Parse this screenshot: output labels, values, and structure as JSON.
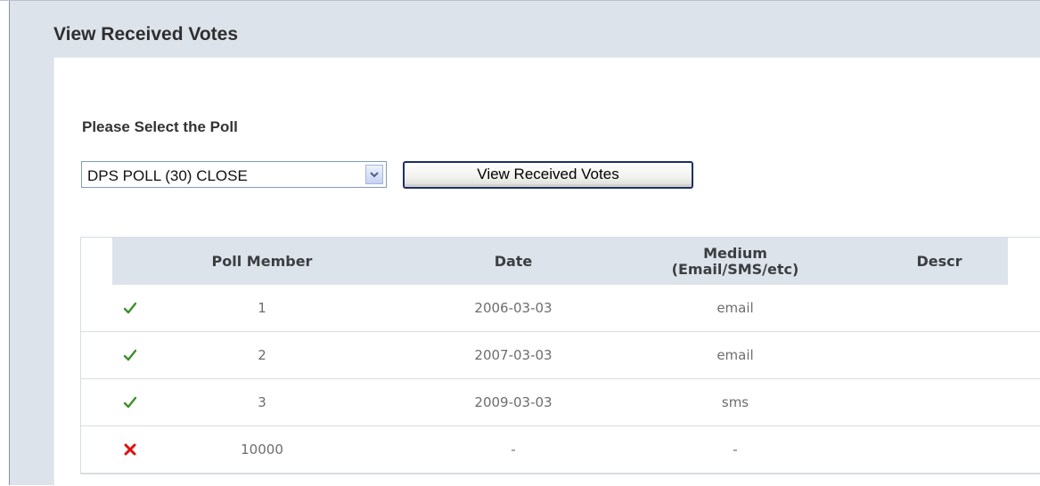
{
  "panel": {
    "title": "View Received Votes"
  },
  "poll_select": {
    "label": "Please Select the Poll",
    "selected": "DPS POLL (30) CLOSE",
    "button_label": "View Received Votes"
  },
  "table": {
    "headers": {
      "member": "Poll Member",
      "date": "Date",
      "medium_line1": "Medium",
      "medium_line2": "(Email/SMS/etc)",
      "descr": "Descr"
    },
    "rows": [
      {
        "status": "received",
        "member": "1",
        "date": "2006-03-03",
        "medium": "email",
        "descr": ""
      },
      {
        "status": "received",
        "member": "2",
        "date": "2007-03-03",
        "medium": "email",
        "descr": ""
      },
      {
        "status": "received",
        "member": "3",
        "date": "2009-03-03",
        "medium": "sms",
        "descr": ""
      },
      {
        "status": "not-received",
        "member": "10000",
        "date": "-",
        "medium": "-",
        "descr": ""
      }
    ]
  },
  "colors": {
    "check": "#3c8f2a",
    "cross": "#e01010",
    "header_bg": "#dce3ea"
  },
  "icons": {
    "received": "check-icon",
    "not_received": "cross-icon",
    "dropdown": "chevron-down-icon"
  }
}
